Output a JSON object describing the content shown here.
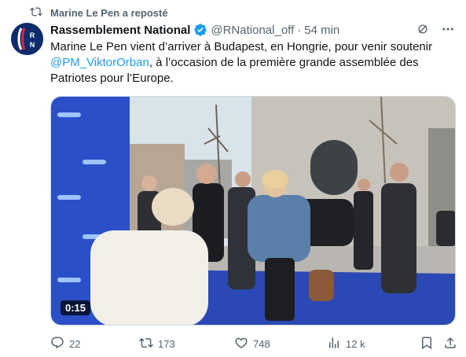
{
  "repost": {
    "text": "Marine Le Pen a reposté",
    "icon": "repost-icon"
  },
  "author": {
    "name": "Rassemblement National",
    "handle": "@RNational_off",
    "separator": "·",
    "time": "54 min",
    "avatar_text": "RN",
    "verified": true
  },
  "tweet": {
    "text_before": "Marine Le Pen vient d’arriver à Budapest, en Hongrie, pour venir soutenir ",
    "mention": "@PM_ViktorOrban",
    "text_after": ", à l’occasion de la première grande assemblée des Patriotes pour l’Europe."
  },
  "media": {
    "duration": "0:15"
  },
  "actions": {
    "replies": "22",
    "reposts": "173",
    "likes": "748",
    "views": "12 k"
  },
  "colors": {
    "accent": "#1d9bf0",
    "muted": "#536471",
    "text": "#0f1419",
    "verified": "#1d9bf0"
  }
}
